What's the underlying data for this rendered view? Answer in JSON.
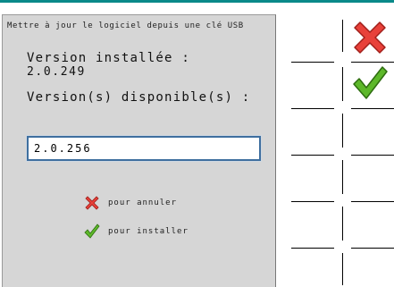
{
  "dialog": {
    "title": "Mettre à jour le logiciel depuis une clé USB",
    "installed_label": "Version installée :",
    "installed_value": "2.0.249",
    "available_label": "Version(s) disponible(s) :",
    "available_value": "2.0.256",
    "legend_cancel": "pour annuler",
    "legend_install": "pour installer"
  },
  "softkeys": {
    "cancel_icon": "red-x-icon",
    "confirm_icon": "green-check-icon"
  },
  "colors": {
    "top_border": "#0a8a8a",
    "panel_bg": "#d6d6d6",
    "cancel_red": "#e8413a",
    "confirm_green": "#5db82a",
    "input_border": "#3f6f9f"
  }
}
